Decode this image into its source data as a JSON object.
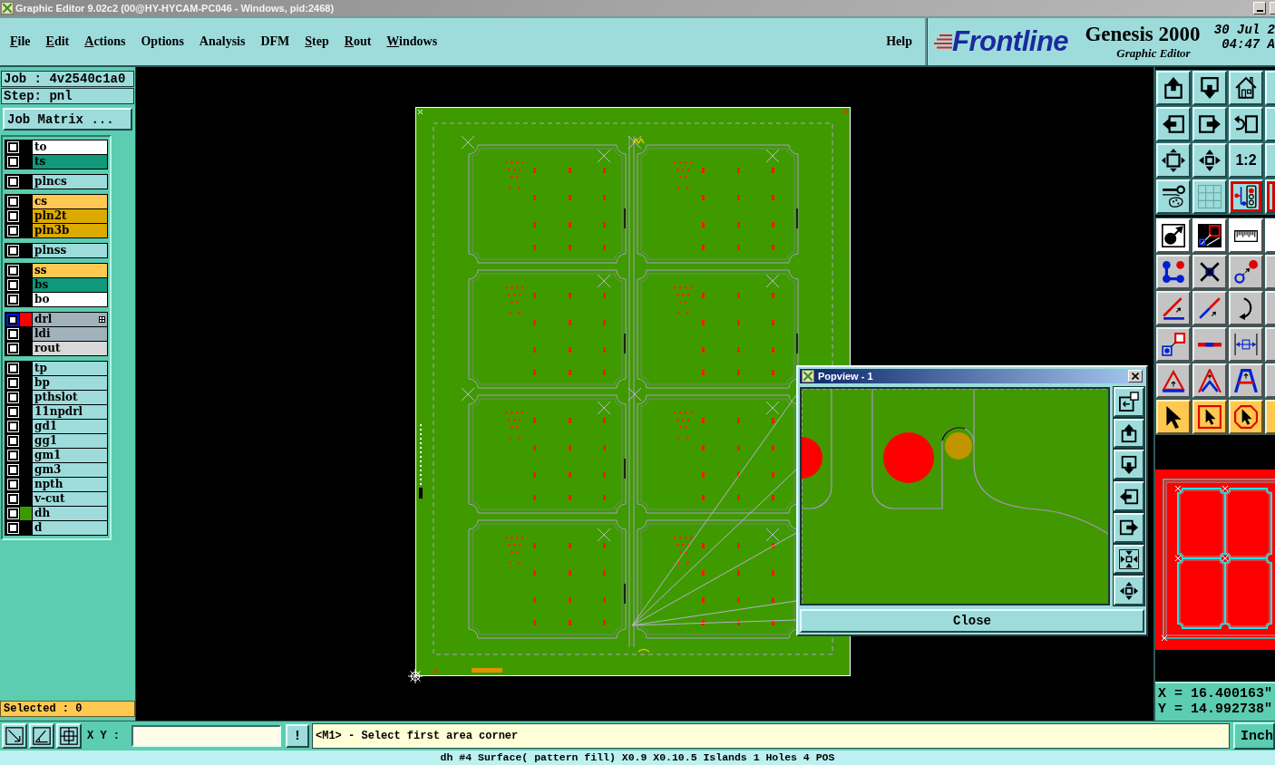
{
  "window": {
    "title": "Graphic Editor 9.02c2 (00@HY-HYCAM-PC046 - Windows, pid:2468)"
  },
  "menu": [
    {
      "label": "File",
      "mnemonic": true
    },
    {
      "label": "Edit",
      "mnemonic": true
    },
    {
      "label": "Actions",
      "mnemonic": true
    },
    {
      "label": "Options",
      "mnemonic": false
    },
    {
      "label": "Analysis",
      "mnemonic": false
    },
    {
      "label": "DFM",
      "mnemonic": false
    },
    {
      "label": "Step",
      "mnemonic": true
    },
    {
      "label": "Rout",
      "mnemonic": true
    },
    {
      "label": "Windows",
      "mnemonic": true
    }
  ],
  "help_menu": {
    "label": "Help"
  },
  "brand": {
    "logo": "Frontline",
    "product": "Genesis 2000",
    "subtitle": "Graphic Editor",
    "date": "30 Jul 2",
    "time": "04:47 A"
  },
  "job_info": {
    "job": "Job : 4v2540c1a0",
    "step": "Step: pnl",
    "matrix_button": "Job Matrix ..."
  },
  "layer_groups": [
    {
      "layers": [
        {
          "name": "to",
          "color": "#ffffff",
          "checked": false,
          "highlighted": false,
          "marker": false
        },
        {
          "name": "ts",
          "color": "#10997a",
          "checked": false,
          "highlighted": false,
          "marker": false
        }
      ]
    },
    {
      "layers": [
        {
          "name": "plncs",
          "color": "#9edcdc",
          "checked": false,
          "highlighted": false,
          "marker": false
        }
      ]
    },
    {
      "layers": [
        {
          "name": "cs",
          "color": "#ffc850",
          "checked": false,
          "highlighted": false,
          "marker": false
        },
        {
          "name": "pln2t",
          "color": "#dcaa00",
          "checked": false,
          "highlighted": false,
          "marker": false
        },
        {
          "name": "pln3b",
          "color": "#dcaa00",
          "checked": false,
          "highlighted": false,
          "marker": false
        }
      ]
    },
    {
      "layers": [
        {
          "name": "plnss",
          "color": "#9edcdc",
          "checked": false,
          "highlighted": false,
          "marker": false
        }
      ]
    },
    {
      "layers": [
        {
          "name": "ss",
          "color": "#ffc850",
          "checked": false,
          "highlighted": false,
          "marker": false
        },
        {
          "name": "bs",
          "color": "#10997a",
          "checked": false,
          "highlighted": false,
          "marker": false
        },
        {
          "name": "bo",
          "color": "#ffffff",
          "checked": false,
          "highlighted": false,
          "marker": false
        }
      ]
    },
    {
      "layers": [
        {
          "name": "drl",
          "color": "#a2b2ba",
          "swatch": {
            "color": "#ff0000"
          },
          "checked": false,
          "highlighted": true,
          "marker": true
        },
        {
          "name": "ldi",
          "color": "#a2b2ba",
          "checked": false,
          "highlighted": false,
          "marker": false
        },
        {
          "name": "rout",
          "color": "#d8d8d8",
          "checked": false,
          "highlighted": false,
          "marker": false
        }
      ]
    },
    {
      "layers": [
        {
          "name": "tp",
          "color": "#9edcdc",
          "checked": false,
          "highlighted": false,
          "marker": false
        },
        {
          "name": "bp",
          "color": "#9edcdc",
          "checked": false,
          "highlighted": false,
          "marker": false
        },
        {
          "name": "pthslot",
          "color": "#9edcdc",
          "checked": false,
          "highlighted": false,
          "marker": false
        },
        {
          "name": "11npdrl",
          "color": "#9edcdc",
          "checked": false,
          "highlighted": false,
          "marker": false
        },
        {
          "name": "gd1",
          "color": "#9edcdc",
          "checked": false,
          "highlighted": false,
          "marker": false
        },
        {
          "name": "gg1",
          "color": "#9edcdc",
          "checked": false,
          "highlighted": false,
          "marker": false
        },
        {
          "name": "gm1",
          "color": "#9edcdc",
          "checked": false,
          "highlighted": false,
          "marker": false
        },
        {
          "name": "gm3",
          "color": "#9edcdc",
          "checked": false,
          "highlighted": false,
          "marker": false
        },
        {
          "name": "npth",
          "color": "#9edcdc",
          "checked": false,
          "highlighted": false,
          "marker": false
        },
        {
          "name": "v-cut",
          "color": "#9edcdc",
          "checked": false,
          "highlighted": false,
          "marker": false
        },
        {
          "name": "dh",
          "color": "#9edcdc",
          "swatch": {
            "color": "#3d9900"
          },
          "checked": false,
          "highlighted": false,
          "marker": false
        },
        {
          "name": "d",
          "color": "#9edcdc",
          "checked": false,
          "highlighted": false,
          "marker": false
        }
      ]
    }
  ],
  "selection": {
    "label": "Selected : 0"
  },
  "popview": {
    "title": "Popview - 1",
    "close_button": "Close"
  },
  "view_toolbar": [
    {
      "kind": "pan-up",
      "selected": false
    },
    {
      "kind": "pan-down",
      "selected": false
    },
    {
      "kind": "home",
      "selected": false
    },
    {
      "kind": "partial",
      "selected": false
    },
    {
      "kind": "pan-left",
      "selected": false
    },
    {
      "kind": "pan-right",
      "selected": false
    },
    {
      "kind": "undo-view",
      "selected": false
    },
    {
      "kind": "partial",
      "selected": false
    },
    {
      "kind": "zoom-fit",
      "selected": false
    },
    {
      "kind": "zoom-center",
      "selected": false
    },
    {
      "kind": "label",
      "label": "1:2",
      "selected": false
    },
    {
      "kind": "partial",
      "selected": false
    },
    {
      "kind": "tools",
      "selected": false
    },
    {
      "kind": "grid",
      "selected": false
    },
    {
      "kind": "layers",
      "selected": true
    },
    {
      "kind": "partial",
      "selected": true
    }
  ],
  "edit_toolbar": [
    {
      "kind": "snap",
      "buttons": [
        {
          "kind": "snap-point"
        },
        {
          "kind": "snap-box"
        },
        {
          "kind": "ruler"
        },
        {
          "kind": "partial"
        }
      ]
    },
    {
      "kind": "edit",
      "buttons": [
        {
          "kind": "nodes"
        },
        {
          "kind": "cross"
        },
        {
          "kind": "move-point"
        },
        {
          "kind": "partial"
        }
      ]
    },
    {
      "kind": "edit",
      "buttons": [
        {
          "kind": "angle"
        },
        {
          "kind": "diagonal"
        },
        {
          "kind": "arc"
        },
        {
          "kind": "partial"
        }
      ]
    },
    {
      "kind": "edit",
      "buttons": [
        {
          "kind": "move-box"
        },
        {
          "kind": "h-line"
        },
        {
          "kind": "dimension"
        },
        {
          "kind": "partial"
        }
      ]
    },
    {
      "kind": "edit",
      "buttons": [
        {
          "kind": "triangle"
        },
        {
          "kind": "peak"
        },
        {
          "kind": "arch"
        },
        {
          "kind": "partial"
        }
      ]
    },
    {
      "kind": "select",
      "buttons": [
        {
          "kind": "pointer"
        },
        {
          "kind": "pointer-box"
        },
        {
          "kind": "pointer-octagon"
        },
        {
          "kind": "partial"
        }
      ]
    }
  ],
  "coordinates": {
    "x": "X = 16.400163\"",
    "y": "Y = 14.992738\""
  },
  "command_bar": {
    "label": "X Y :",
    "alert_button": "!",
    "prompt": "<M1> - Select first area corner",
    "units_button": "Inch"
  },
  "status_line": "dh #4 Surface( pattern fill) X0.9 X0.10.5 Islands 1 Holes 4 POS"
}
